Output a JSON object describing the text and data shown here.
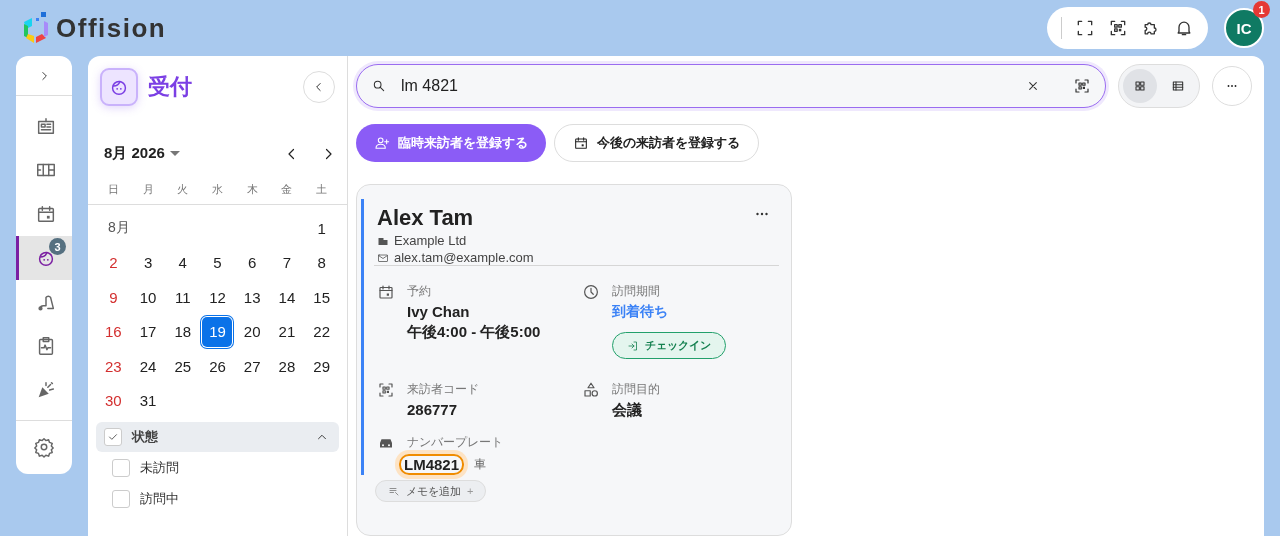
{
  "app": {
    "name": "Offision"
  },
  "top_toolbar": {
    "icons": [
      {
        "kind": "fullscreen"
      },
      {
        "kind": "qr"
      },
      {
        "kind": "puzzle"
      },
      {
        "kind": "bell"
      }
    ],
    "avatar": {
      "initials": "IC",
      "badge": "1"
    }
  },
  "rail": {
    "items": [
      {
        "kind": "building",
        "selected": false
      },
      {
        "kind": "floorplan",
        "selected": false
      },
      {
        "kind": "calendar",
        "selected": false
      },
      {
        "kind": "visitor",
        "selected": true,
        "badge": "3"
      },
      {
        "kind": "cleaning",
        "selected": false
      },
      {
        "kind": "health",
        "selected": false
      },
      {
        "kind": "party",
        "selected": false
      }
    ]
  },
  "page": {
    "title": "受付"
  },
  "calendar": {
    "month": "8月 2026",
    "weekdays": [
      "日",
      "月",
      "火",
      "水",
      "木",
      "金",
      "土"
    ],
    "weeks": [
      {
        "label": "8月",
        "days": [
          {
            "day": "1",
            "selected": false
          }
        ]
      },
      {
        "days": [
          {
            "day": "2",
            "selected": false
          },
          {
            "day": "3",
            "selected": false
          },
          {
            "day": "4",
            "selected": false
          },
          {
            "day": "5",
            "selected": false
          },
          {
            "day": "6",
            "selected": false
          },
          {
            "day": "7",
            "selected": false
          },
          {
            "day": "8",
            "selected": false
          }
        ]
      },
      {
        "days": [
          {
            "day": "9",
            "selected": false
          },
          {
            "day": "10",
            "selected": false
          },
          {
            "day": "11",
            "selected": false
          },
          {
            "day": "12",
            "selected": false
          },
          {
            "day": "13",
            "selected": false
          },
          {
            "day": "14",
            "selected": false
          },
          {
            "day": "15",
            "selected": false
          }
        ]
      },
      {
        "days": [
          {
            "day": "16",
            "selected": false
          },
          {
            "day": "17",
            "selected": false
          },
          {
            "day": "18",
            "selected": false
          },
          {
            "day": "19",
            "selected": true
          },
          {
            "day": "20",
            "selected": false
          },
          {
            "day": "21",
            "selected": false
          },
          {
            "day": "22",
            "selected": false
          }
        ]
      },
      {
        "days": [
          {
            "day": "23",
            "selected": false
          },
          {
            "day": "24",
            "selected": false
          },
          {
            "day": "25",
            "selected": false
          },
          {
            "day": "26",
            "selected": false
          },
          {
            "day": "27",
            "selected": false
          },
          {
            "day": "28",
            "selected": false
          },
          {
            "day": "29",
            "selected": false
          }
        ]
      },
      {
        "days": [
          {
            "day": "30",
            "selected": false
          },
          {
            "day": "31",
            "selected": false
          }
        ]
      }
    ]
  },
  "filter": {
    "label": "状態",
    "checked": true,
    "expanded": true,
    "options": [
      {
        "label": "未訪問",
        "checked": false
      },
      {
        "label": "訪問中",
        "checked": false
      }
    ]
  },
  "search": {
    "value": "lm 4821"
  },
  "view_toggle": [
    {
      "kind": "grid",
      "selected": true
    },
    {
      "kind": "list",
      "selected": false
    }
  ],
  "actions": [
    {
      "kind": "primary",
      "label": "臨時来訪者を登録する"
    },
    {
      "kind": "secondary",
      "label": "今後の来訪者を登録する"
    }
  ],
  "visitor_card": {
    "name": "Alex Tam",
    "company": "Example Ltd",
    "email": "alex.tam@example.com",
    "fields": [
      {
        "kind": "booking",
        "label": "予約",
        "lines": [
          "Ivy Chan",
          "午後4:00 - 午後5:00"
        ]
      },
      {
        "kind": "period",
        "label": "訪問期間",
        "status": "到着待ち",
        "button": "チェックイン"
      },
      {
        "kind": "code",
        "label": "来訪者コード",
        "lines": [
          "286777"
        ]
      },
      {
        "kind": "purpose",
        "label": "訪問目的",
        "lines": [
          "会議"
        ]
      },
      {
        "kind": "plate",
        "label": "ナンバープレート",
        "plate": "LM4821",
        "vehicle": "車"
      }
    ],
    "memo_button": {
      "label": "メモを追加",
      "plus": "+"
    }
  }
}
